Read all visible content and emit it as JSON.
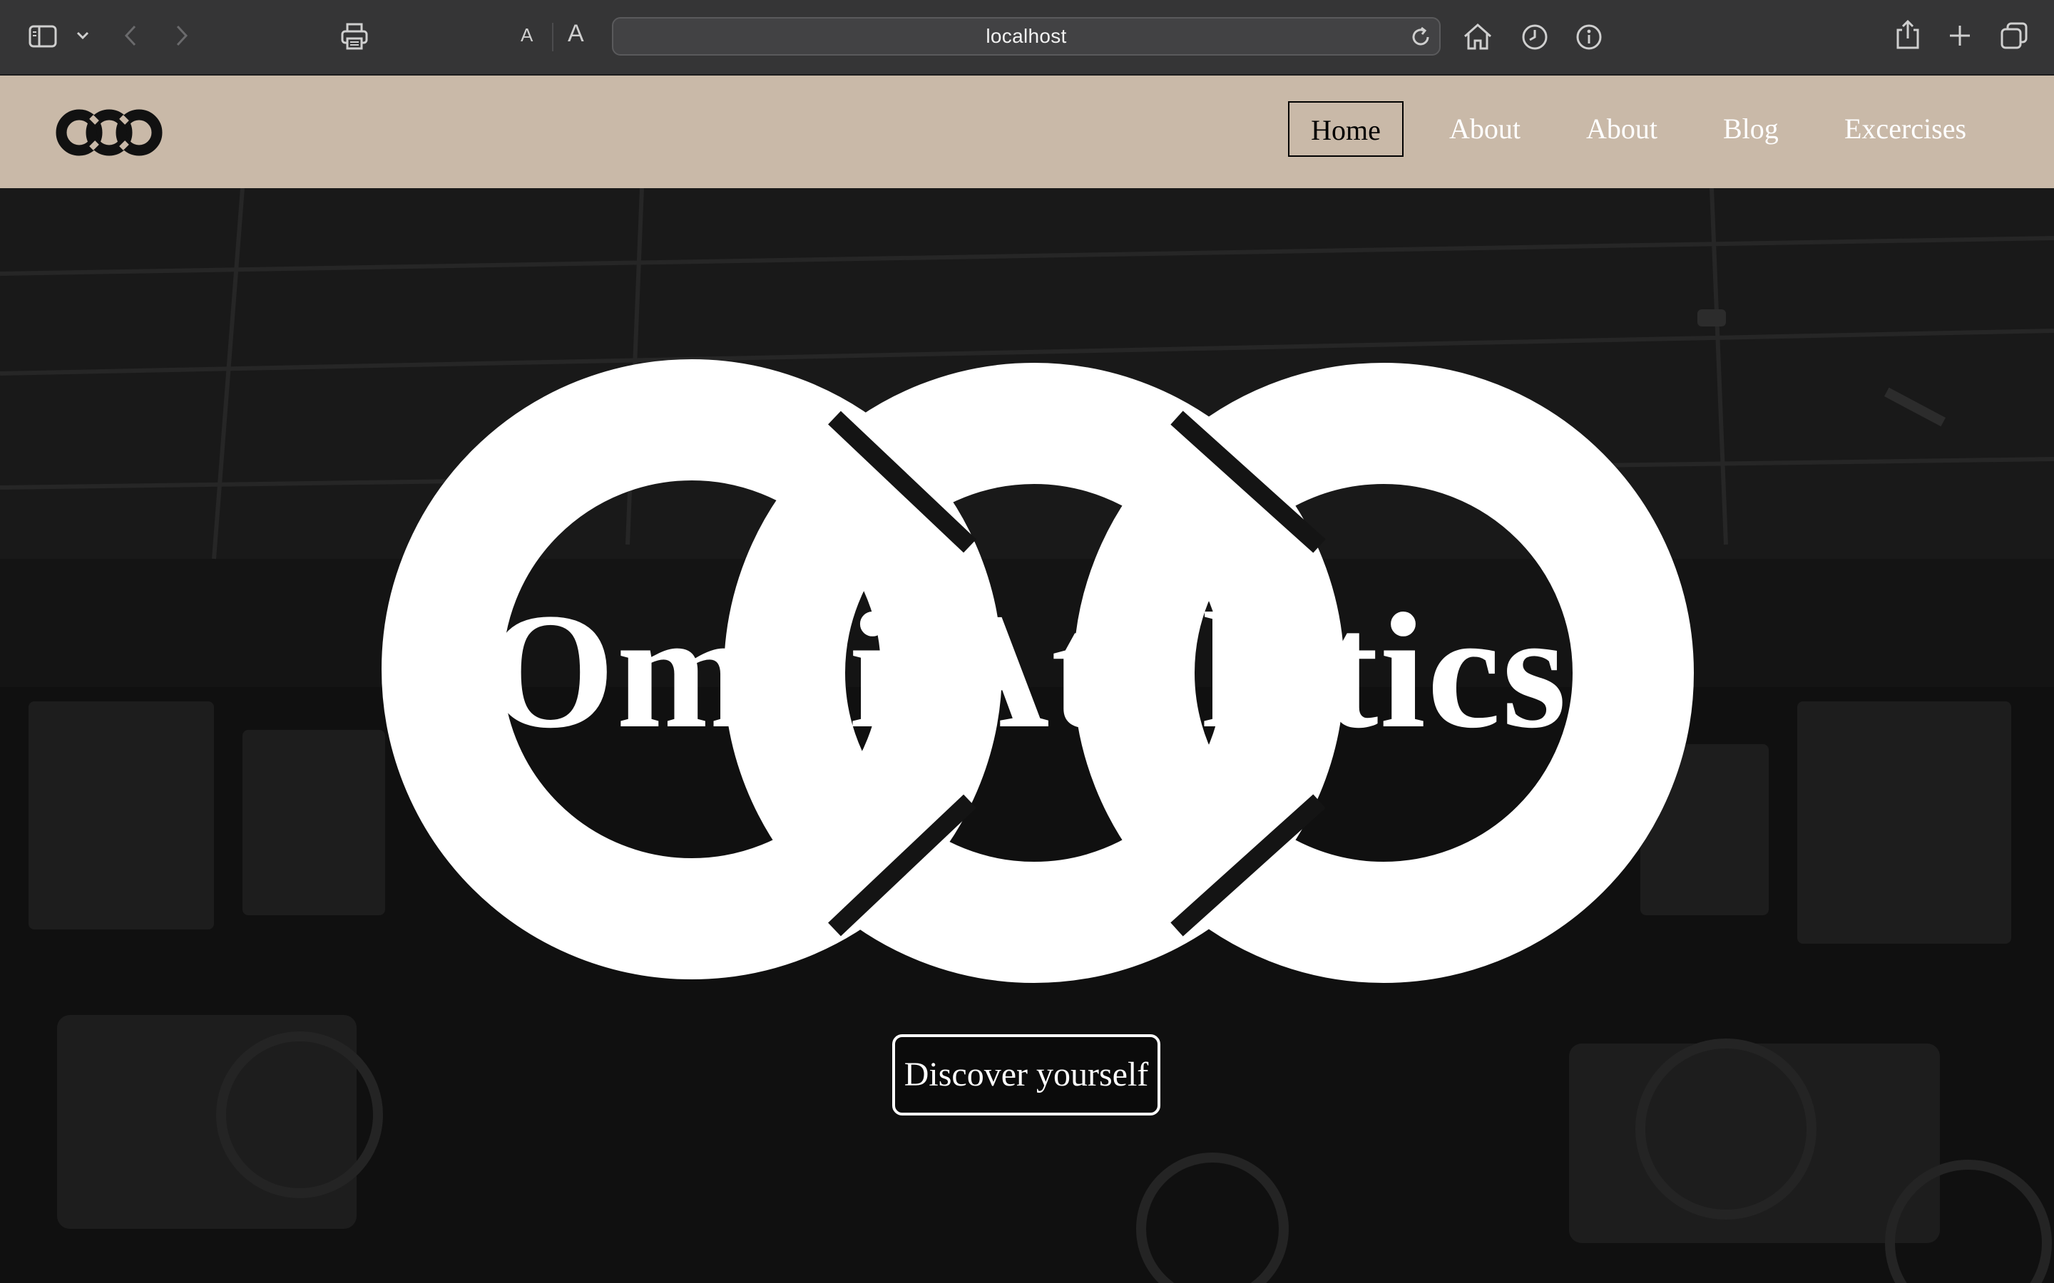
{
  "browser": {
    "address": "localhost",
    "text_size_small": "A",
    "text_size_large": "A"
  },
  "site": {
    "nav": {
      "home": "Home",
      "about_1": "About",
      "about_2": "About",
      "blog": "Blog",
      "exercises": "Excercises"
    },
    "hero": {
      "title": "Omni Athletics",
      "cta": "Discover yourself"
    }
  },
  "colors": {
    "header_bg": "#c9b9a8",
    "chrome_bg": "#353536",
    "hero_text": "#ffffff"
  }
}
